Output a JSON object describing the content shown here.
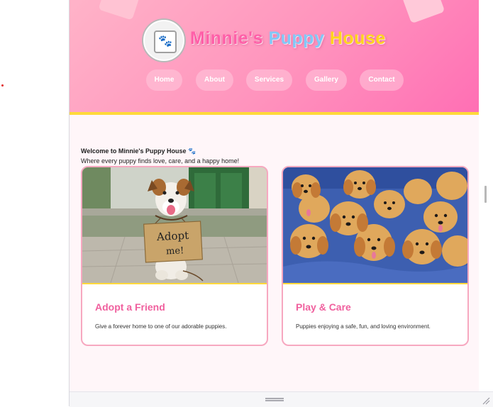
{
  "header": {
    "title_part1": "Minnie's",
    "title_part2": "Puppy",
    "title_part3": "House",
    "logo_icon": "paw-print-icon",
    "colors": {
      "pink": "#ff5fa8",
      "blue": "#82c8f7",
      "yellow": "#ffd51e",
      "accent_border": "#ffd93a"
    }
  },
  "nav": {
    "items": [
      {
        "label": "Home"
      },
      {
        "label": "About"
      },
      {
        "label": "Services"
      },
      {
        "label": "Gallery"
      },
      {
        "label": "Contact"
      }
    ]
  },
  "welcome": {
    "heading": "Welcome to Minnie's Puppy House 🐾",
    "subtitle": "Where every puppy finds love, care, and a happy home!"
  },
  "cards": [
    {
      "title": "Adopt a Friend",
      "text": "Give a forever home to one of our adorable puppies.",
      "image": "dog-adopt-me-sign-photo",
      "sign_text": "Adopt me!"
    },
    {
      "title": "Play & Care",
      "text": "Puppies enjoying a safe, fun, and loving environment.",
      "image": "golden-retriever-puppies-photo"
    }
  ]
}
